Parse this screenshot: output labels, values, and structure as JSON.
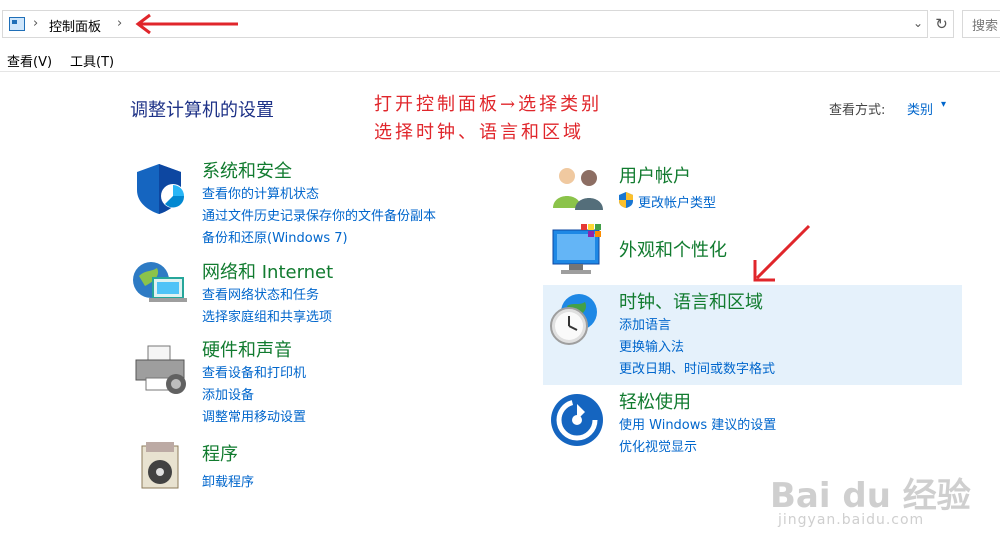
{
  "address_bar": {
    "breadcrumb": "控制面板",
    "search_placeholder": "搜索"
  },
  "menu": {
    "view": "查看(V)",
    "tools": "工具(T)"
  },
  "main": {
    "heading": "调整计算机的设置",
    "view_by_label": "查看方式:",
    "view_by_value": "类别"
  },
  "annotation": {
    "line1": "打开控制面板→选择类别",
    "line2": "选择时钟、语言和区域"
  },
  "categories_left": [
    {
      "title": "系统和安全",
      "links": [
        "查看你的计算机状态",
        "通过文件历史记录保存你的文件备份副本",
        "备份和还原(Windows 7)"
      ]
    },
    {
      "title": "网络和 Internet",
      "links": [
        "查看网络状态和任务",
        "选择家庭组和共享选项"
      ]
    },
    {
      "title": "硬件和声音",
      "links": [
        "查看设备和打印机",
        "添加设备",
        "调整常用移动设置"
      ]
    },
    {
      "title": "程序",
      "links": [
        "卸载程序"
      ]
    }
  ],
  "categories_right": [
    {
      "title": "用户帐户",
      "links": [
        "更改帐户类型"
      ]
    },
    {
      "title": "外观和个性化",
      "links": []
    },
    {
      "title": "时钟、语言和区域",
      "links": [
        "添加语言",
        "更换输入法",
        "更改日期、时间或数字格式"
      ]
    },
    {
      "title": "轻松使用",
      "links": [
        "使用 Windows 建议的设置",
        "优化视觉显示"
      ]
    }
  ],
  "watermark": {
    "logo": "Bai du 经验",
    "url": "jingyan.baidu.com"
  },
  "colors": {
    "category_title": "#117b2f",
    "link": "#0066cc",
    "heading": "#1e3287",
    "annotation": "#e0262b",
    "highlight": "#e5f1fb"
  }
}
